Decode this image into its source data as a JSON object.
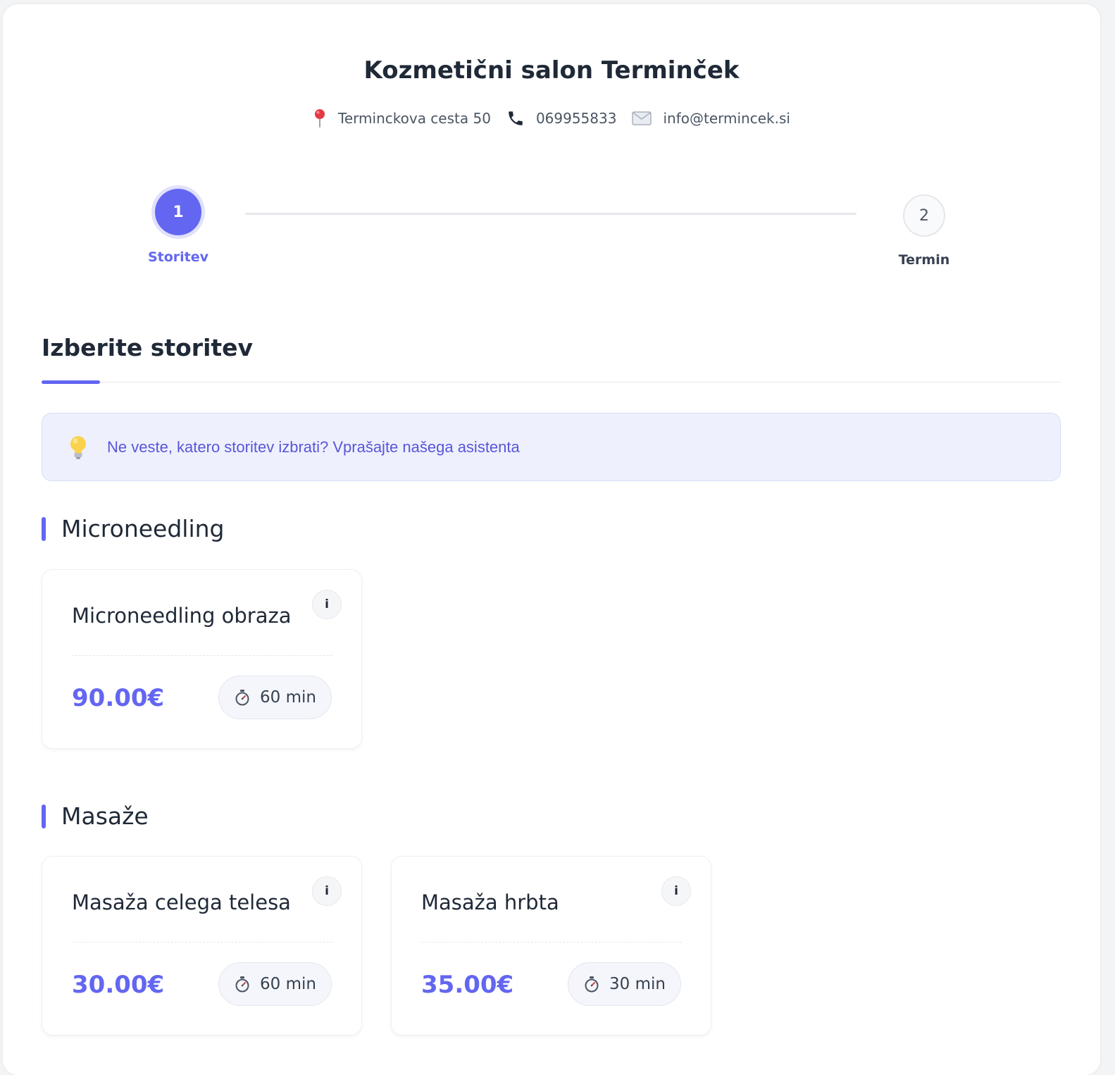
{
  "header": {
    "title": "Kozmetični salon Terminček",
    "address": "Terminckova cesta 50",
    "phone": "069955833",
    "email": "info@termincek.si"
  },
  "stepper": {
    "steps": [
      {
        "number": "1",
        "label": "Storitev",
        "active": true
      },
      {
        "number": "2",
        "label": "Termin",
        "active": false
      }
    ]
  },
  "main": {
    "section_title": "Izberite storitev",
    "assistant_prompt": "Ne veste, katero storitev izbrati? Vprašajte našega asistenta",
    "categories": [
      {
        "title": "Microneedling",
        "services": [
          {
            "name": "Microneedling obraza",
            "price": "90.00€",
            "duration": "60 min",
            "info": "i"
          }
        ]
      },
      {
        "title": "Masaže",
        "services": [
          {
            "name": "Masaža celega telesa",
            "price": "30.00€",
            "duration": "60 min",
            "info": "i"
          },
          {
            "name": "Masaža hrbta",
            "price": "35.00€",
            "duration": "30 min",
            "info": "i"
          }
        ]
      }
    ]
  },
  "colors": {
    "accent": "#6366f1",
    "banner_bg": "#eef1fd",
    "text_dark": "#1f2937"
  },
  "icons": {
    "address": "pin-icon",
    "phone": "phone-icon",
    "email": "envelope-icon",
    "assistant": "lightbulb-icon",
    "duration": "stopwatch-icon"
  }
}
